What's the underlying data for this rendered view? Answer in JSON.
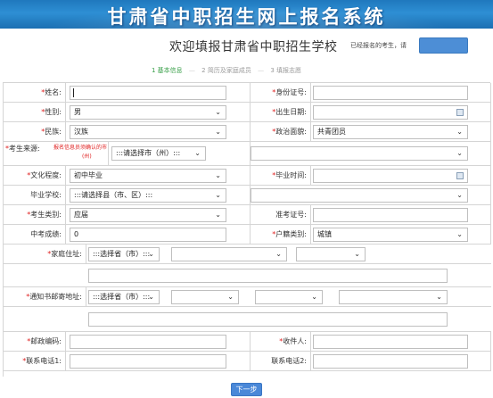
{
  "banner": {
    "title": "甘肃省中职招生网上报名系统"
  },
  "header": {
    "heading": "欢迎填报甘肃省中职招生学校",
    "registered_hint": "已经报名的考生，请",
    "login_button": ""
  },
  "steps": [
    {
      "label": "1 基本信息",
      "active": true
    },
    {
      "label": "2 简历及家庭成员",
      "active": false
    },
    {
      "label": "3 填报志愿",
      "active": false
    }
  ],
  "form": {
    "name_label": "姓名:",
    "id_label": "身份证号:",
    "gender_label": "性别:",
    "gender_value": "男",
    "birth_label": "出生日期:",
    "ethnicity_label": "民族:",
    "ethnicity_value": "汉族",
    "political_label": "政治面貌:",
    "political_value": "共青团员",
    "origin_label": "考生来源:",
    "origin_note_line1": "报名信息员须确认的市",
    "origin_note_line2": "(州)",
    "origin_select": ":::请选择市（州）:::",
    "education_label": "文化程度:",
    "education_value": "初中毕业",
    "grad_time_label": "毕业时间:",
    "school_label": "毕业学校:",
    "school_select": ":::请选择县（市、区）:::",
    "category_label": "考生类别:",
    "category_value": "应届",
    "ticket_label": "准考证号:",
    "score_label": "中考成绩:",
    "score_value": "0",
    "household_label": "户籍类别:",
    "household_value": "城镇",
    "address_label": "家庭住址:",
    "address_province": ":::选择省（市）:::",
    "mail_label": "通知书邮寄地址:",
    "mail_province": ":::选择省（市）:::",
    "postcode_label": "邮政编码:",
    "recipient_label": "收件人:",
    "phone1_label": "联系电话1:",
    "phone2_label": "联系电话2:"
  },
  "actions": {
    "next": "下一步"
  },
  "colors": {
    "accent": "#4a88d8",
    "required": "#e02020",
    "step_active": "#3aa04a"
  }
}
